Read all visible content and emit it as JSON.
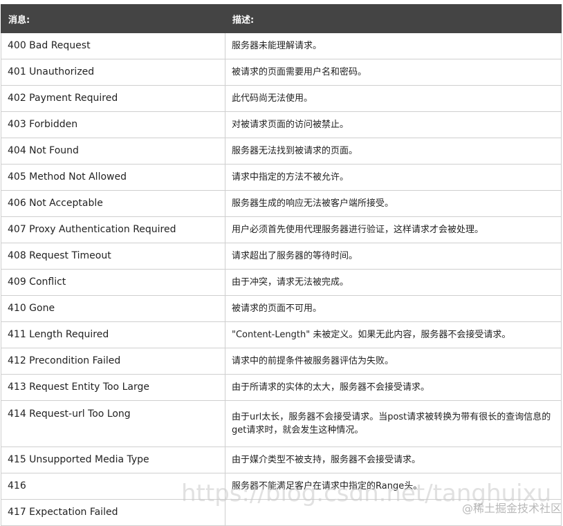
{
  "header": {
    "message": "消息:",
    "description": "描述:"
  },
  "rows": [
    {
      "message": "400 Bad Request",
      "description": "服务器未能理解请求。"
    },
    {
      "message": "401 Unauthorized",
      "description": "被请求的页面需要用户名和密码。"
    },
    {
      "message": "402 Payment Required",
      "description": "此代码尚无法使用。"
    },
    {
      "message": "403 Forbidden",
      "description": "对被请求页面的访问被禁止。"
    },
    {
      "message": "404 Not Found",
      "description": "服务器无法找到被请求的页面。"
    },
    {
      "message": "405 Method Not Allowed",
      "description": "请求中指定的方法不被允许。"
    },
    {
      "message": "406 Not Acceptable",
      "description": "服务器生成的响应无法被客户端所接受。"
    },
    {
      "message": "407 Proxy Authentication Required",
      "description": "用户必须首先使用代理服务器进行验证，这样请求才会被处理。"
    },
    {
      "message": "408 Request Timeout",
      "description": "请求超出了服务器的等待时间。"
    },
    {
      "message": "409 Conflict",
      "description": "由于冲突，请求无法被完成。"
    },
    {
      "message": "410 Gone",
      "description": "被请求的页面不可用。"
    },
    {
      "message": "411 Length Required",
      "description": "\"Content-Length\" 未被定义。如果无此内容，服务器不会接受请求。"
    },
    {
      "message": "412 Precondition Failed",
      "description": "请求中的前提条件被服务器评估为失败。"
    },
    {
      "message": "413 Request Entity Too Large",
      "description": "由于所请求的实体的太大，服务器不会接受请求。"
    },
    {
      "message": "414 Request-url Too Long",
      "description": "由于url太长，服务器不会接受请求。当post请求被转换为带有很长的查询信息的get请求时，就会发生这种情况。"
    },
    {
      "message": "415 Unsupported Media Type",
      "description": "由于媒介类型不被支持，服务器不会接受请求。"
    },
    {
      "message": "416",
      "description": "服务器不能满足客户在请求中指定的Range头。"
    },
    {
      "message": "417 Expectation Failed",
      "description": ""
    }
  ],
  "watermark": {
    "url": "https://blog.csdn.net/tanghuixu",
    "brand": "@稀土掘金技术社区"
  }
}
